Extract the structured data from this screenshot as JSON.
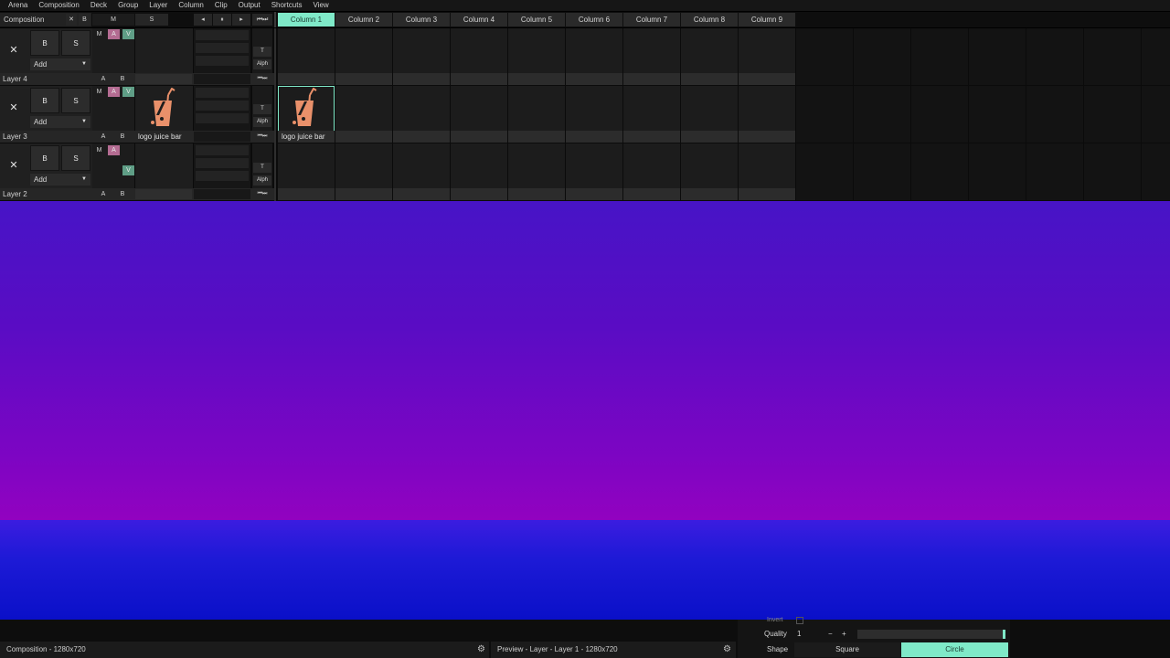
{
  "menu": [
    "Arena",
    "Composition",
    "Deck",
    "Group",
    "Layer",
    "Column",
    "Clip",
    "Output",
    "Shortcuts",
    "View"
  ],
  "header": {
    "composition_label": "Composition",
    "x_label": "✕",
    "b_label": "B",
    "m_label": "M",
    "s_label": "S",
    "prev_icon": "◂",
    "pause_icon": "⏸",
    "next_icon": "▸",
    "skip_icon": "⏮⏭"
  },
  "columns": [
    "Column 1",
    "Column 2",
    "Column 3",
    "Column 4",
    "Column 5",
    "Column 6",
    "Column 7",
    "Column 8",
    "Column 9"
  ],
  "active_column": "Column 1",
  "layers": [
    {
      "name": "Layer 4",
      "add_label": "Add",
      "b": "B",
      "s": "S",
      "a_letter": "A",
      "b_letter": "B",
      "thumb_label": "",
      "clip_label": ""
    },
    {
      "name": "Layer 3",
      "add_label": "Add",
      "b": "B",
      "s": "S",
      "a_letter": "A",
      "b_letter": "B",
      "thumb_label": "logo juice bar",
      "clip_label": "logo juice bar"
    },
    {
      "name": "Layer 2",
      "add_label": "Add",
      "b": "B",
      "s": "S",
      "a_letter": "A",
      "b_letter": "B",
      "thumb_label": "",
      "clip_label": ""
    }
  ],
  "tags": {
    "m": "M",
    "a": "A",
    "v": "V",
    "t": "T",
    "alph": "Alph"
  },
  "status": {
    "composition": "Composition - 1280x720",
    "preview": "Preview - Layer - Layer 1 - 1280x720",
    "gear_icon": "⚙"
  },
  "params": {
    "quality_label": "Quality",
    "quality_value": "1",
    "minus": "−",
    "plus": "+",
    "shape_label": "Shape",
    "shape_options": [
      "Square",
      "Circle"
    ],
    "shape_selected": "Circle",
    "invert_label": "Invert"
  },
  "colors": {
    "accent": "#7fe9c8",
    "tag_a": "#b46c92",
    "tag_v": "#5f9e86",
    "output_top_start": "#4714c6",
    "output_top_end": "#9202c0",
    "output_bottom": "#0a10c8"
  }
}
